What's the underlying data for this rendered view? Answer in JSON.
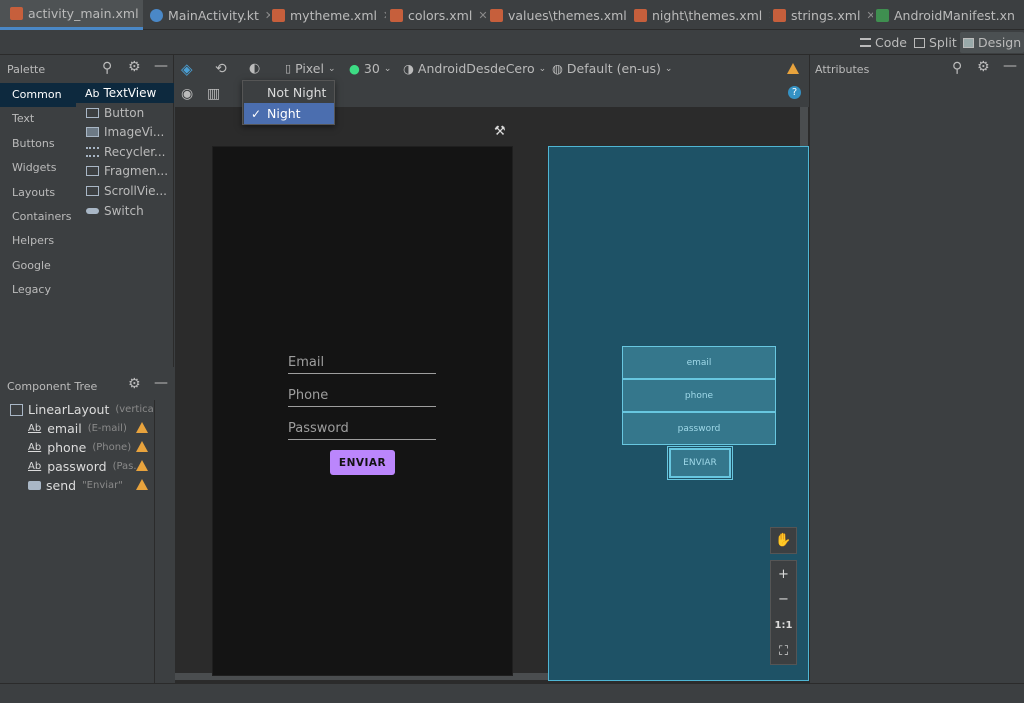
{
  "tabs": [
    {
      "label": "activity_main.xml",
      "icon": "xml-layout-icon",
      "active": true
    },
    {
      "label": "MainActivity.kt",
      "icon": "kotlin-file-icon"
    },
    {
      "label": "mytheme.xml",
      "icon": "xml-file-icon"
    },
    {
      "label": "colors.xml",
      "icon": "xml-file-icon"
    },
    {
      "label": "values\\themes.xml",
      "icon": "xml-file-icon"
    },
    {
      "label": "night\\themes.xml",
      "icon": "xml-file-icon"
    },
    {
      "label": "strings.xml",
      "icon": "xml-file-icon"
    },
    {
      "label": "AndroidManifest.xn",
      "icon": "manifest-file-icon"
    }
  ],
  "view_modes": {
    "code": "Code",
    "split": "Split",
    "design": "Design",
    "selected": "Design"
  },
  "palette": {
    "title": "Palette",
    "categories": [
      "Common",
      "Text",
      "Buttons",
      "Widgets",
      "Layouts",
      "Containers",
      "Helpers",
      "Google",
      "Legacy"
    ],
    "selected_category": "Common",
    "items": [
      {
        "prefix": "Ab",
        "label": "TextView"
      },
      {
        "label": "Button"
      },
      {
        "label": "ImageVi..."
      },
      {
        "label": "Recycler..."
      },
      {
        "label": "Fragmen..."
      },
      {
        "label": "ScrollVie..."
      },
      {
        "label": "Switch"
      }
    ]
  },
  "component_tree": {
    "title": "Component Tree",
    "root": {
      "label": "LinearLayout",
      "detail": "(vertical)"
    },
    "children": [
      {
        "label": "email",
        "detail": "(E-mail)",
        "warning": true
      },
      {
        "label": "phone",
        "detail": "(Phone)",
        "warning": true
      },
      {
        "label": "password",
        "detail": "(Pas...",
        "warning": true
      },
      {
        "label": "send",
        "detail": "\"Enviar\"",
        "warning": true
      }
    ]
  },
  "toolbar": {
    "device": "Pixel",
    "api": "30",
    "theme": "AndroidDesdeCero",
    "locale": "Default (en-us)"
  },
  "night_mode_menu": {
    "options": [
      "Not Night",
      "Night"
    ],
    "selected": "Night"
  },
  "design_preview": {
    "fields": [
      "Email",
      "Phone",
      "Password"
    ],
    "button": "ENVIAR"
  },
  "blueprint": {
    "fields": [
      "email",
      "phone",
      "password"
    ],
    "button": "ENVIAR"
  },
  "zoom_controls": {
    "actual_size": "1:1"
  },
  "attributes": {
    "title": "Attributes"
  },
  "colors": {
    "background": "#3c3f41",
    "canvas": "#2b2b2b",
    "phone_background": "#141414",
    "button_accent": "#bb86fc",
    "blueprint_fill": "#1e5266",
    "warning": "#e8a33d",
    "selection": "#4b6eaf"
  }
}
